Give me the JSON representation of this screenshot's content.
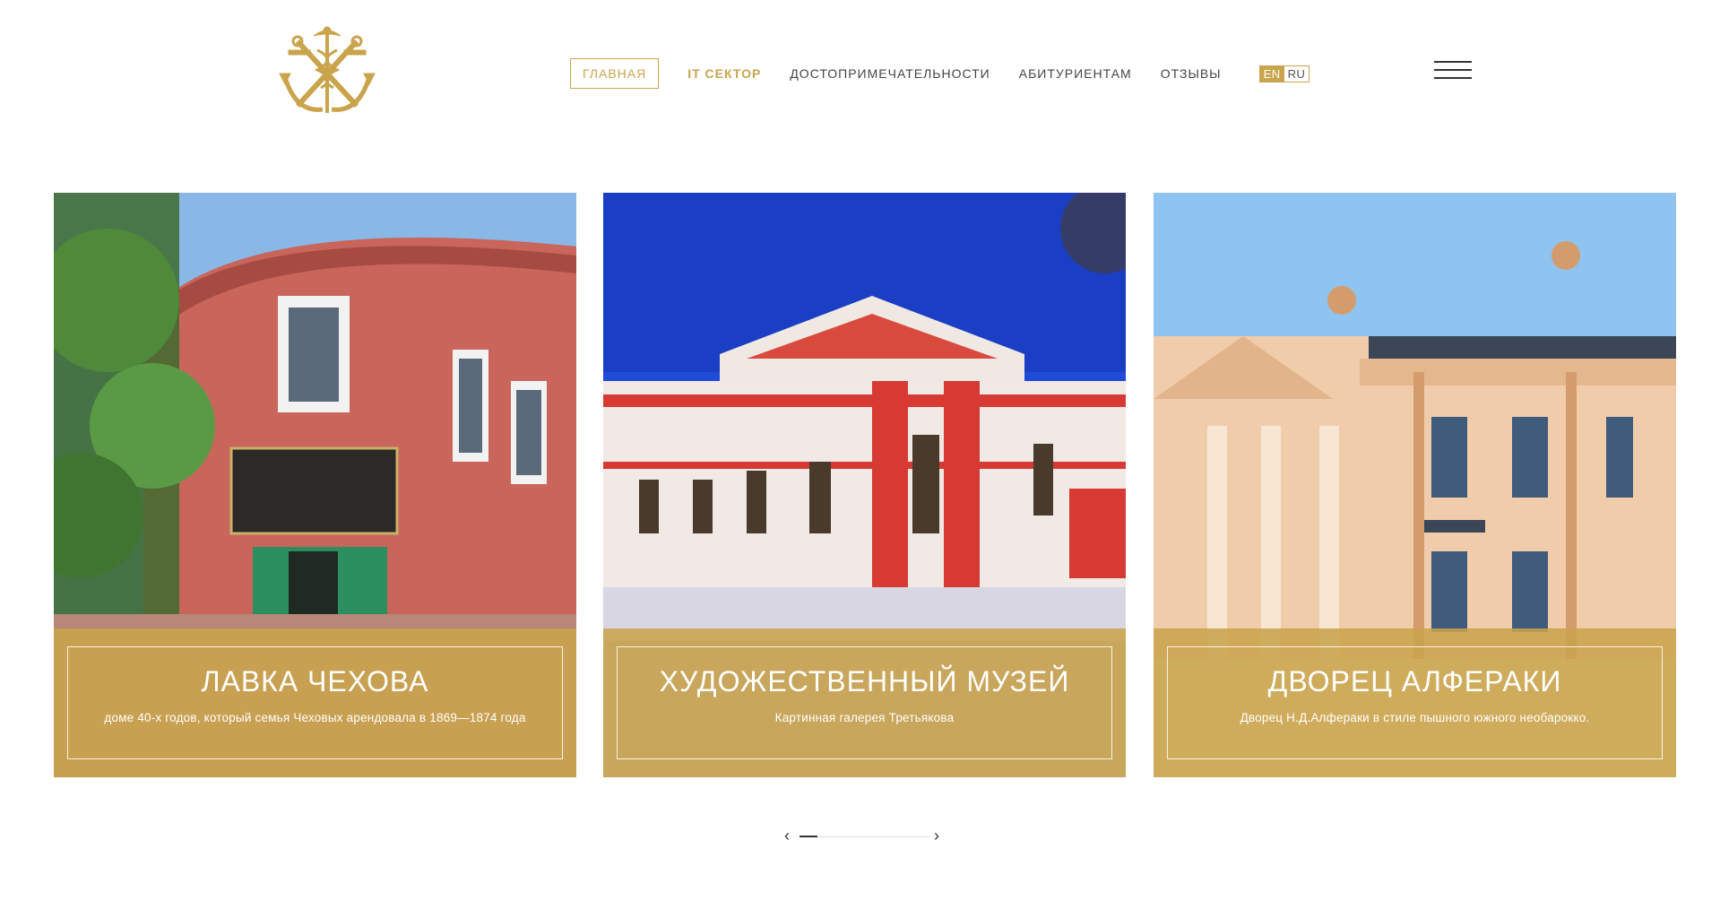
{
  "brand": {
    "logo_icon": "anchor-caduceus-logo-icon",
    "accent": "#c9a44c"
  },
  "nav": {
    "items": [
      {
        "label": "ГЛАВНАЯ"
      },
      {
        "label": "IT СЕКТОР"
      },
      {
        "label": "ДОСТОПРИМЕЧАТЕЛЬНОСТИ"
      },
      {
        "label": "АБИТУРИЕНТАМ"
      },
      {
        "label": "ОТЗЫВЫ"
      }
    ],
    "lang": {
      "en": "EN",
      "ru": "RU"
    }
  },
  "cards": [
    {
      "title": "ЛАВКА ЧЕХОВА",
      "desc": "доме 40-х годов, который семья Чеховых арендовала в 1869—1874 года"
    },
    {
      "title": "ХУДОЖЕСТВЕННЫЙ МУЗЕЙ",
      "desc": "Картинная галерея Третьякова"
    },
    {
      "title": "ДВОРЕЦ АЛФЕРАКИ",
      "desc": "Дворец Н.Д.Алфераки в стиле пышного южного необарокко."
    }
  ],
  "slider": {
    "prev_icon": "chevron-left-icon",
    "next_icon": "chevron-right-icon",
    "progress": 0.14
  }
}
